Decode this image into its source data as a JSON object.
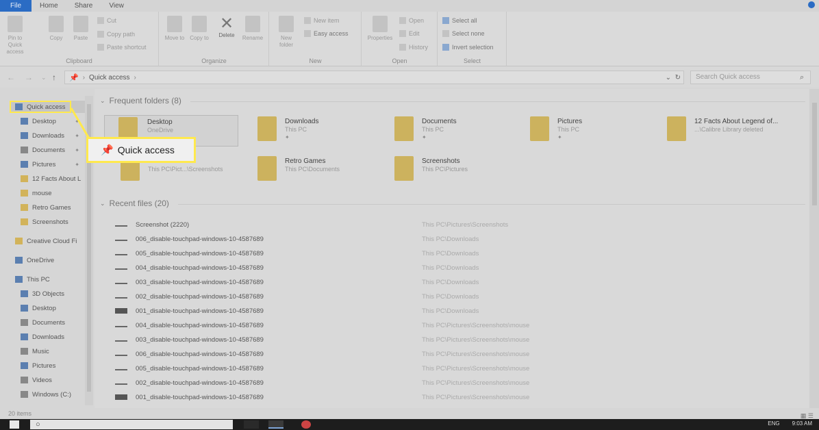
{
  "tabs": {
    "file": "File",
    "home": "Home",
    "share": "Share",
    "view": "View"
  },
  "ribbon": {
    "clipboard": {
      "label": "Clipboard",
      "pin": "Pin to Quick access",
      "copy": "Copy",
      "paste": "Paste",
      "cut": "Cut",
      "copy_path": "Copy path",
      "paste_shortcut": "Paste shortcut"
    },
    "organize": {
      "label": "Organize",
      "move_to": "Move to",
      "copy_to": "Copy to",
      "delete": "Delete",
      "rename": "Rename"
    },
    "new": {
      "label": "New",
      "new_folder": "New folder",
      "new_item": "New item",
      "easy_access": "Easy access"
    },
    "open": {
      "label": "Open",
      "properties": "Properties",
      "open": "Open",
      "edit": "Edit",
      "history": "History"
    },
    "select": {
      "label": "Select",
      "select_all": "Select all",
      "select_none": "Select none",
      "invert": "Invert selection"
    }
  },
  "address": {
    "path": "Quick access",
    "search_placeholder": "Search Quick access"
  },
  "nav": {
    "items": [
      {
        "label": "Quick access"
      },
      {
        "label": "Desktop"
      },
      {
        "label": "Downloads"
      },
      {
        "label": "Documents"
      },
      {
        "label": "Pictures"
      },
      {
        "label": "12 Facts About L"
      },
      {
        "label": "mouse"
      },
      {
        "label": "Retro Games"
      },
      {
        "label": "Screenshots"
      },
      {
        "label": "Creative Cloud Fi"
      },
      {
        "label": "OneDrive"
      },
      {
        "label": "This PC"
      },
      {
        "label": "3D Objects"
      },
      {
        "label": "Desktop"
      },
      {
        "label": "Documents"
      },
      {
        "label": "Downloads"
      },
      {
        "label": "Music"
      },
      {
        "label": "Pictures"
      },
      {
        "label": "Videos"
      },
      {
        "label": "Windows (C:)"
      }
    ]
  },
  "frequent": {
    "header": "Frequent folders (8)",
    "tiles": [
      {
        "name": "Desktop",
        "sub": "OneDrive"
      },
      {
        "name": "Downloads",
        "sub": "This PC"
      },
      {
        "name": "Documents",
        "sub": "This PC"
      },
      {
        "name": "Pictures",
        "sub": "This PC"
      },
      {
        "name": "12 Facts About Legend of...",
        "sub": "...\\Calibre Library deleted"
      },
      {
        "name": "",
        "sub": "This PC\\Pict...\\Screenshots"
      },
      {
        "name": "Retro Games",
        "sub": "This PC\\Documents"
      },
      {
        "name": "Screenshots",
        "sub": "This PC\\Pictures"
      }
    ]
  },
  "recent": {
    "header": "Recent files (20)",
    "files": [
      {
        "name": "Screenshot (2220)",
        "path": "This PC\\Pictures\\Screenshots"
      },
      {
        "name": "006_disable-touchpad-windows-10-4587689",
        "path": "This PC\\Downloads"
      },
      {
        "name": "005_disable-touchpad-windows-10-4587689",
        "path": "This PC\\Downloads"
      },
      {
        "name": "004_disable-touchpad-windows-10-4587689",
        "path": "This PC\\Downloads"
      },
      {
        "name": "003_disable-touchpad-windows-10-4587689",
        "path": "This PC\\Downloads"
      },
      {
        "name": "002_disable-touchpad-windows-10-4587689",
        "path": "This PC\\Downloads"
      },
      {
        "name": "001_disable-touchpad-windows-10-4587689",
        "path": "This PC\\Downloads"
      },
      {
        "name": "004_disable-touchpad-windows-10-4587689",
        "path": "This PC\\Pictures\\Screenshots\\mouse"
      },
      {
        "name": "003_disable-touchpad-windows-10-4587689",
        "path": "This PC\\Pictures\\Screenshots\\mouse"
      },
      {
        "name": "006_disable-touchpad-windows-10-4587689",
        "path": "This PC\\Pictures\\Screenshots\\mouse"
      },
      {
        "name": "005_disable-touchpad-windows-10-4587689",
        "path": "This PC\\Pictures\\Screenshots\\mouse"
      },
      {
        "name": "002_disable-touchpad-windows-10-4587689",
        "path": "This PC\\Pictures\\Screenshots\\mouse"
      },
      {
        "name": "001_disable-touchpad-windows-10-4587689",
        "path": "This PC\\Pictures\\Screenshots\\mouse"
      }
    ]
  },
  "status": {
    "count": "20 items"
  },
  "taskbar": {
    "lang": "ENG",
    "time": "9:03 AM"
  },
  "callout": {
    "label": "Quick access"
  },
  "colors": {
    "accent": "#2b6cc4",
    "highlight": "#ffe94d",
    "folder": "#d2b35a"
  }
}
